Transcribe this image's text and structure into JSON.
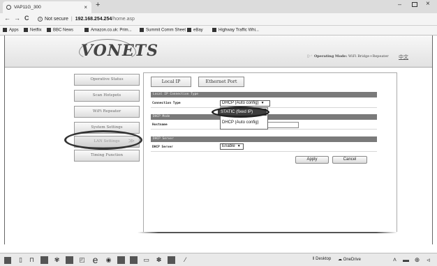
{
  "browser": {
    "tab_title": "VAP11G_300",
    "tab_close": "×",
    "new_tab": "+",
    "nav_back": "←",
    "nav_forward": "→",
    "nav_reload": "C",
    "security_label": "Not secure",
    "url_host": "192.168.254.254",
    "url_path": "/home.asp",
    "bookmarks": [
      "Apps",
      "Netflix",
      "BBC News",
      "Amazon.co.uk: Prim...",
      "Summit Comm Sheet",
      "eBay",
      "Highway Traffic Whi..."
    ]
  },
  "router": {
    "logo": "VONETS",
    "operating_mode_prefix": "Operating Mode:",
    "operating_mode_value": "WiFi Bridge+Repeater",
    "language_link": "中文"
  },
  "sidebar": {
    "items": [
      {
        "label": "Operative Status"
      },
      {
        "label": "Scan Hotspots"
      },
      {
        "label": "WiFi Repeater"
      },
      {
        "label": "System Settings"
      },
      {
        "label": "LAN Settings",
        "arrows": "≫"
      },
      {
        "label": "Timing Function"
      }
    ]
  },
  "main": {
    "tabs": [
      "Local IP",
      "Ethernet Port"
    ],
    "sections": {
      "local_ip": {
        "header": "Local IP Connection Type",
        "connection_type_label": "Connection Type",
        "connection_type_value": "DHCP (Auto config)"
      },
      "dhcp_mode": {
        "header": "DHCP Mode",
        "hostname_label": "Hostname"
      },
      "dhcp_server": {
        "header": "DHCP Server",
        "dhcp_server_label": "DHCP Server",
        "dhcp_server_value": "Enable"
      }
    },
    "dropdown_options": [
      "STATIC (fixed IP)",
      "DHCP (Auto config)"
    ],
    "buttons": {
      "apply": "Apply",
      "cancel": "Cancel"
    }
  },
  "taskbar": {
    "desktop_label": "Desktop",
    "onedrive_label": "OneDrive"
  }
}
